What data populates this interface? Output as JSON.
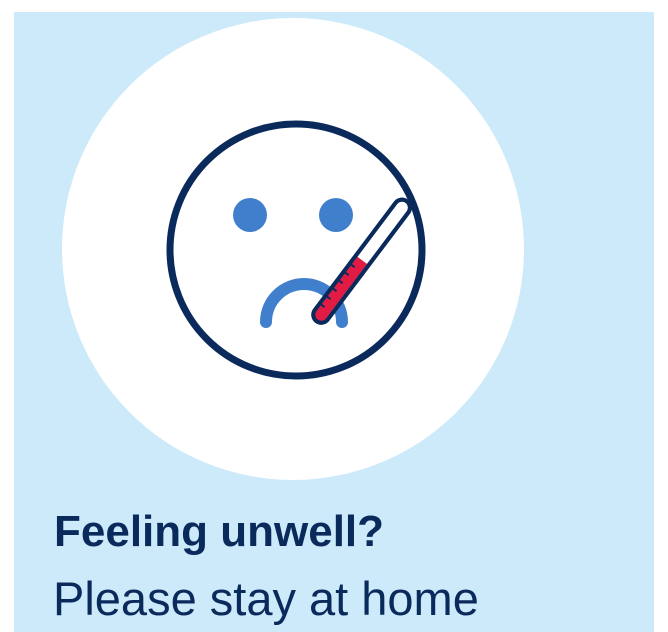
{
  "poster": {
    "headline": "Feeling unwell?",
    "subline": "Please stay at home"
  },
  "illustration": {
    "icon": "sick-face-with-thermometer-icon"
  },
  "colors": {
    "background": "#cceaf9",
    "circle": "#ffffff",
    "navy": "#0b2a5c",
    "face_blue": "#3f7fcc",
    "thermometer_red": "#e11b44",
    "thermometer_white": "#ffffff"
  }
}
